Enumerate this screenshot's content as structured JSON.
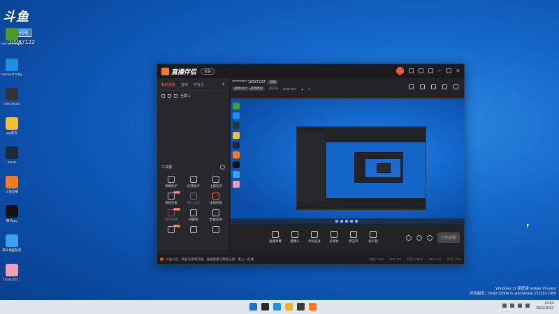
{
  "desktop": {
    "brand": {
      "logo_text": "斗鱼",
      "room_tag": "房间号",
      "room_number": "10287122"
    },
    "icons": [
      {
        "label": "GeForce Experience",
        "color": "#4c9a2a",
        "icon": "geforce-icon"
      },
      {
        "label": "Microsoft Edge",
        "color": "#1d8fe0",
        "icon": "edge-icon"
      },
      {
        "label": "OBS Studio",
        "color": "#333333",
        "icon": "obs-icon"
      },
      {
        "label": "QQ影音",
        "color": "#f2c32e",
        "icon": "qqplayer-icon"
      },
      {
        "label": "Steam",
        "color": "#1b2838",
        "icon": "steam-icon"
      },
      {
        "label": "斗鱼直播",
        "color": "#ff7a1a",
        "icon": "douyu-icon"
      },
      {
        "label": "腾讯QQ",
        "color": "#111111",
        "icon": "qq-icon"
      },
      {
        "label": "腾讯电脑管家",
        "color": "#3aa0f0",
        "icon": "guanjia-icon"
      },
      {
        "label": "TGAN2021...",
        "color": "#f0a0b0",
        "icon": "pig-icon"
      }
    ]
  },
  "app": {
    "brand_name": "直播伴侣",
    "version_label": "体验",
    "scene_tabs": [
      "我的场景",
      "直播",
      "可变页"
    ],
    "source_item": "全屏 1",
    "toolbox_title": "工具箱",
    "tools": [
      {
        "label": "弹幕助手",
        "tag": "",
        "state": "normal"
      },
      {
        "label": "房管助手",
        "tag": "",
        "state": "normal"
      },
      {
        "label": "主播任务",
        "tag": "",
        "state": "normal"
      },
      {
        "label": "视频连麦",
        "tag": "NEW",
        "state": "normal"
      },
      {
        "label": "录入连麦",
        "tag": "",
        "state": "dim"
      },
      {
        "label": "虚拟形象",
        "tag": "",
        "state": "highlight"
      },
      {
        "label": "前往开播",
        "tag": "NEW",
        "state": "dim"
      },
      {
        "label": "弹幕库",
        "tag": "",
        "state": "normal"
      },
      {
        "label": "数据助手",
        "tag": "",
        "state": "normal"
      },
      {
        "label": "",
        "tag": "NEW",
        "state": "normal"
      },
      {
        "label": "",
        "tag": "",
        "state": "normal"
      },
      {
        "label": "",
        "tag": "",
        "state": "normal"
      }
    ],
    "room": {
      "title": "**********  10287122",
      "edit_tag": "修改",
      "category": "战地2042 · 战地模拟",
      "room_label": "房间号",
      "room_id": "10287122",
      "popularity": "0"
    },
    "controls": [
      "直播弹幕",
      "摄像头",
      "手机投屏",
      "多媒体",
      "麦克风",
      "扬声器"
    ],
    "start_button": "开始直播",
    "status": {
      "notice": "斗鱼公告：请合法使用开播、直播请遵守相关法律，更上一层楼",
      "stats": [
        "丢帧: 0.0%",
        "FPS: 30",
        "码率: 0 kb/s",
        "CPU: 9%",
        "内存: 11%"
      ]
    }
  },
  "taskbar": {
    "time": "10:24",
    "date": "2021/11/22"
  },
  "watermark": {
    "line1": "Windows 11 家庭版 Insider Preview",
    "line2": "评估副本。Build 22504.rs_prerelease.211112-1650"
  }
}
